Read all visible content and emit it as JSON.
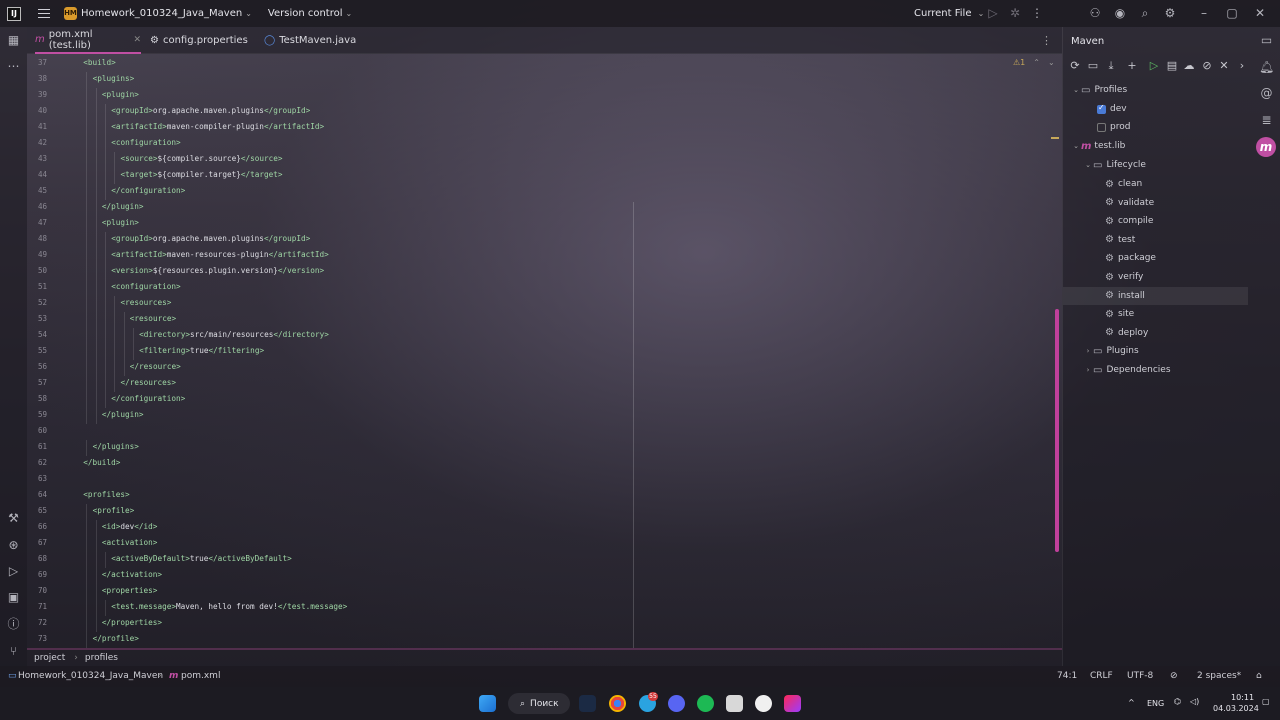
{
  "titlebar": {
    "project_badge": "HM",
    "project_name": "Homework_010324_Java_Maven",
    "version_control": "Version control",
    "current_file": "Current File"
  },
  "tabs": [
    {
      "icon": "m",
      "label": "pom.xml (test.lib)",
      "active": true
    },
    {
      "icon": "gear",
      "label": "config.properties",
      "active": false
    },
    {
      "icon": "circle",
      "label": "TestMaven.java",
      "active": false
    }
  ],
  "editor": {
    "inspection_count": "1",
    "lines": [
      {
        "n": "37",
        "indent": 1,
        "text": "<build>"
      },
      {
        "n": "38",
        "indent": 2,
        "text": "<plugins>"
      },
      {
        "n": "39",
        "indent": 3,
        "text": "<plugin>"
      },
      {
        "n": "40",
        "indent": 4,
        "text": "<groupId>org.apache.maven.plugins</groupId>"
      },
      {
        "n": "41",
        "indent": 4,
        "text": "<artifactId>maven-compiler-plugin</artifactId>"
      },
      {
        "n": "42",
        "indent": 4,
        "text": "<configuration>"
      },
      {
        "n": "43",
        "indent": 5,
        "text": "<source>${compiler.source}</source>"
      },
      {
        "n": "44",
        "indent": 5,
        "text": "<target>${compiler.target}</target>"
      },
      {
        "n": "45",
        "indent": 4,
        "text": "</configuration>"
      },
      {
        "n": "46",
        "indent": 3,
        "text": "</plugin>"
      },
      {
        "n": "47",
        "indent": 3,
        "text": "<plugin>"
      },
      {
        "n": "48",
        "indent": 4,
        "text": "<groupId>org.apache.maven.plugins</groupId>"
      },
      {
        "n": "49",
        "indent": 4,
        "text": "<artifactId>maven-resources-plugin</artifactId>"
      },
      {
        "n": "50",
        "indent": 4,
        "text": "<version>${resources.plugin.version}</version>"
      },
      {
        "n": "51",
        "indent": 4,
        "text": "<configuration>"
      },
      {
        "n": "52",
        "indent": 5,
        "text": "<resources>"
      },
      {
        "n": "53",
        "indent": 6,
        "text": "<resource>"
      },
      {
        "n": "54",
        "indent": 7,
        "text": "<directory>src/main/resources</directory>"
      },
      {
        "n": "55",
        "indent": 7,
        "text": "<filtering>true</filtering>"
      },
      {
        "n": "56",
        "indent": 6,
        "text": "</resource>"
      },
      {
        "n": "57",
        "indent": 5,
        "text": "</resources>"
      },
      {
        "n": "58",
        "indent": 4,
        "text": "</configuration>"
      },
      {
        "n": "59",
        "indent": 3,
        "text": "</plugin>"
      },
      {
        "n": "60",
        "indent": 0,
        "text": ""
      },
      {
        "n": "61",
        "indent": 2,
        "text": "</plugins>"
      },
      {
        "n": "62",
        "indent": 1,
        "text": "</build>"
      },
      {
        "n": "63",
        "indent": 0,
        "text": ""
      },
      {
        "n": "64",
        "indent": 1,
        "text": "<profiles>"
      },
      {
        "n": "65",
        "indent": 2,
        "text": "<profile>"
      },
      {
        "n": "66",
        "indent": 3,
        "text": "<id>dev</id>"
      },
      {
        "n": "67",
        "indent": 3,
        "text": "<activation>"
      },
      {
        "n": "68",
        "indent": 4,
        "text": "<activeByDefault>true</activeByDefault>"
      },
      {
        "n": "69",
        "indent": 3,
        "text": "</activation>"
      },
      {
        "n": "70",
        "indent": 3,
        "text": "<properties>"
      },
      {
        "n": "71",
        "indent": 4,
        "text": "<test.message>Maven, hello from dev!</test.message>"
      },
      {
        "n": "72",
        "indent": 3,
        "text": "</properties>"
      },
      {
        "n": "73",
        "indent": 2,
        "text": "</profile>"
      }
    ]
  },
  "breadcrumbs": [
    "project",
    "profiles"
  ],
  "maven": {
    "title": "Maven",
    "profiles_label": "Profiles",
    "profiles": [
      {
        "name": "dev",
        "checked": true
      },
      {
        "name": "prod",
        "checked": false
      }
    ],
    "project": "test.lib",
    "lifecycle_label": "Lifecycle",
    "lifecycle": [
      "clean",
      "validate",
      "compile",
      "test",
      "package",
      "verify",
      "install",
      "site",
      "deploy"
    ],
    "selected_goal": "install",
    "plugins_label": "Plugins",
    "dependencies_label": "Dependencies"
  },
  "statusbar": {
    "project": "Homework_010324_Java_Maven",
    "file": "pom.xml",
    "position": "74:1",
    "line_sep": "CRLF",
    "encoding": "UTF-8",
    "indent": "2 spaces*"
  },
  "taskbar": {
    "search": "Поиск",
    "telegram_badge": "55",
    "lang": "ENG",
    "time": "10:11",
    "date": "04.03.2024"
  },
  "colors": {
    "accent": "#c04fa3",
    "xml_tag": "#9fd6a5",
    "warning": "#c7a85a",
    "run_green": "#5dbb63"
  }
}
